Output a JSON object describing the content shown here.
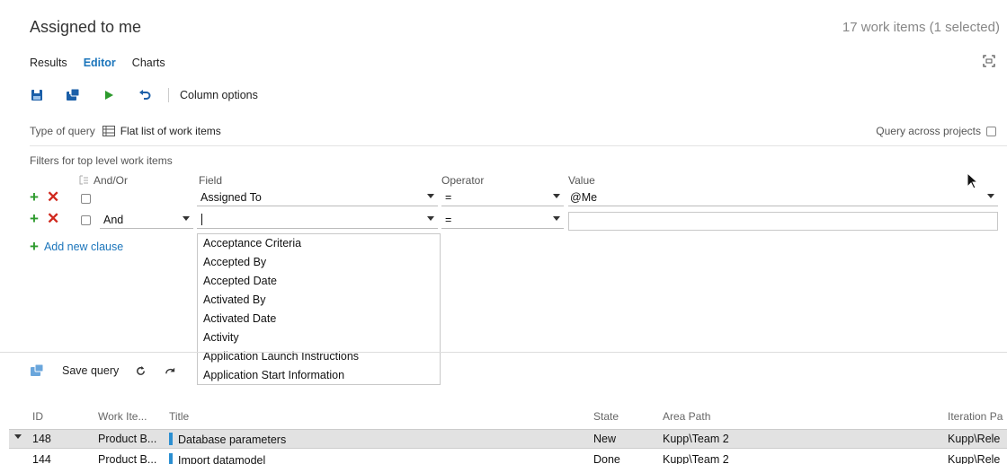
{
  "header": {
    "title": "Assigned to me",
    "count": "17 work items (1 selected)"
  },
  "tabs": [
    {
      "label": "Results",
      "active": false
    },
    {
      "label": "Editor",
      "active": true
    },
    {
      "label": "Charts",
      "active": false
    }
  ],
  "toolbar": {
    "icons": [
      "save-icon",
      "save-as-icon",
      "run-icon",
      "undo-icon"
    ],
    "column_options": "Column options"
  },
  "query_type": {
    "label": "Type of query",
    "value": "Flat list of work items",
    "across_projects": "Query across projects",
    "across_projects_checked": false
  },
  "filters": {
    "label": "Filters for top level work items",
    "headers": {
      "andor": "And/Or",
      "field": "Field",
      "operator": "Operator",
      "value": "Value"
    },
    "clauses": [
      {
        "andor": "",
        "field": "Assigned To",
        "operator": "=",
        "value": "@Me"
      },
      {
        "andor": "And",
        "field": "",
        "operator": "=",
        "value": ""
      }
    ],
    "add_clause": "Add new clause"
  },
  "field_dropdown": [
    "Acceptance Criteria",
    "Accepted By",
    "Accepted Date",
    "Activated By",
    "Activated Date",
    "Activity",
    "Application Launch Instructions",
    "Application Start Information"
  ],
  "results_toolbar": {
    "save_query": "Save query"
  },
  "results": {
    "columns": [
      "ID",
      "Work Ite...",
      "Title",
      "State",
      "Area Path",
      "Iteration Pa"
    ],
    "rows": [
      {
        "id": "148",
        "type": "Product B...",
        "title": "Database parameters",
        "state": "New",
        "area": "Kupp\\Team 2",
        "iteration": "Kupp\\Rele",
        "selected": true
      },
      {
        "id": "144",
        "type": "Product B...",
        "title": "Import datamodel",
        "state": "Done",
        "area": "Kupp\\Team 2",
        "iteration": "Kupp\\Rele",
        "selected": false
      }
    ]
  },
  "colors": {
    "accent": "#1b75bb",
    "add": "#2c9a2c",
    "remove": "#d0281d",
    "workitem": "#2b8fd1"
  }
}
